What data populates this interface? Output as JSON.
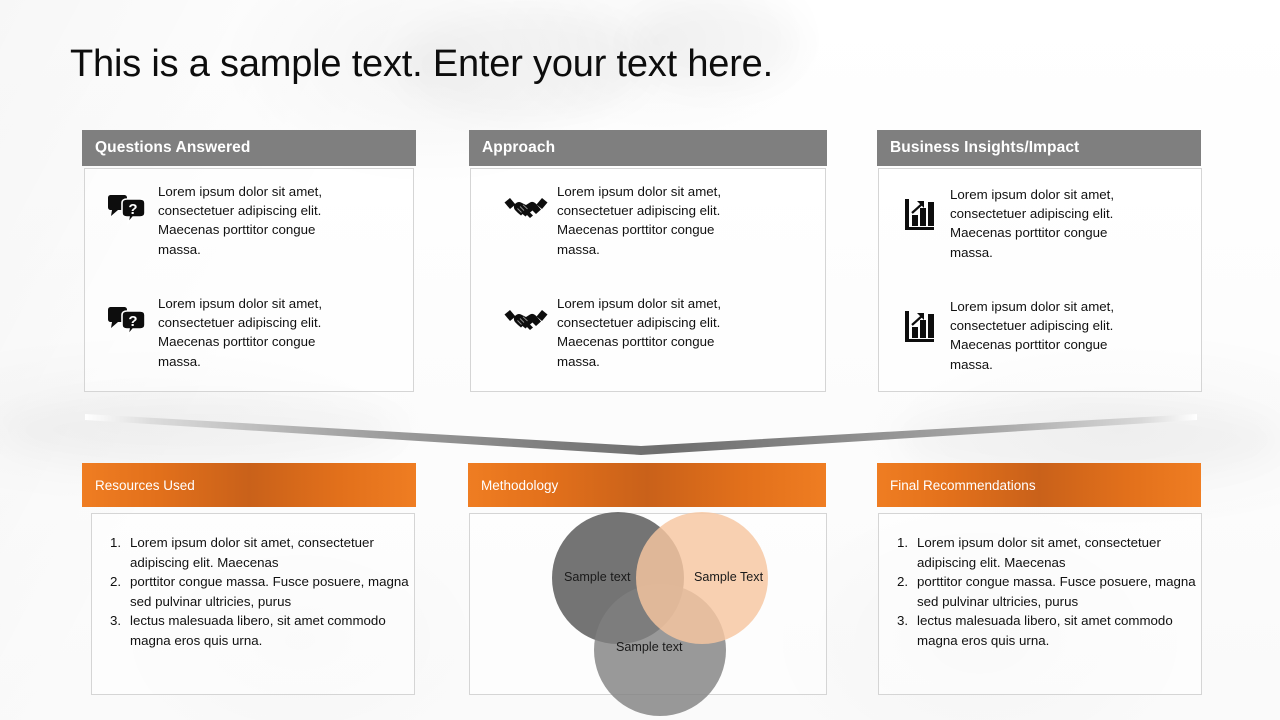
{
  "slide": {
    "title": "This is a sample text. Enter your text here.",
    "colors": {
      "gray_header": "#7f7f7f",
      "orange_header": "#ef7d22",
      "orange_header_dark": "#c9611a",
      "card_border": "#d5d5d5",
      "text": "#111111",
      "venn_dark_gray": "#616161",
      "venn_peach": "#f6c6a0",
      "venn_mid_gray": "#808080",
      "chevron_gray": "#808080"
    }
  },
  "top_cards": [
    {
      "title": "Questions Answered",
      "icon": "speech-bubbles-question-icon",
      "rows": [
        {
          "text": "Lorem ipsum dolor sit amet, consectetuer adipiscing elit. Maecenas porttitor congue massa."
        },
        {
          "text": "Lorem ipsum dolor sit amet, consectetuer adipiscing elit. Maecenas porttitor congue massa."
        }
      ]
    },
    {
      "title": "Approach",
      "icon": "handshake-icon",
      "rows": [
        {
          "text": "Lorem ipsum dolor sit amet, consectetuer adipiscing elit. Maecenas porttitor congue massa."
        },
        {
          "text": "Lorem ipsum dolor sit amet, consectetuer adipiscing elit. Maecenas porttitor congue massa."
        }
      ]
    },
    {
      "title": "Business Insights/Impact",
      "icon": "bar-chart-growth-icon",
      "rows": [
        {
          "text": "Lorem ipsum dolor sit amet, consectetuer adipiscing elit. Maecenas porttitor congue massa."
        },
        {
          "text": "Lorem ipsum dolor sit amet, consectetuer adipiscing elit. Maecenas porttitor congue massa."
        }
      ]
    }
  ],
  "bottom_cards": [
    {
      "title": "Resources Used",
      "content_type": "numbered-list",
      "items": [
        {
          "marker": "1.",
          "text": "Lorem ipsum dolor sit amet, consectetuer adipiscing elit. Maecenas"
        },
        {
          "marker": "2.",
          "text": "porttitor congue massa. Fusce posuere, magna sed pulvinar ultricies, purus"
        },
        {
          "marker": "3.",
          "text": "lectus malesuada libero, sit amet commodo magna eros quis urna."
        }
      ]
    },
    {
      "title": "Methodology",
      "content_type": "venn-diagram"
    },
    {
      "title": "Final Recommendations",
      "content_type": "numbered-list",
      "items": [
        {
          "marker": "1.",
          "text": "Lorem ipsum dolor sit amet, consectetuer adipiscing elit. Maecenas"
        },
        {
          "marker": "2.",
          "text": "porttitor congue massa. Fusce posuere, magna sed pulvinar ultricies, purus"
        },
        {
          "marker": "3.",
          "text": "lectus malesuada libero, sit amet commodo magna eros quis urna."
        }
      ]
    }
  ],
  "venn": {
    "circles": [
      {
        "label": "Sample text",
        "position": "left",
        "color": "#616161"
      },
      {
        "label": "Sample Text",
        "position": "right",
        "color": "#f6c6a0"
      },
      {
        "label": "Sample text",
        "position": "bottom",
        "color": "#808080"
      }
    ]
  },
  "chevron": {
    "shape": "downward-chevron-divider"
  }
}
